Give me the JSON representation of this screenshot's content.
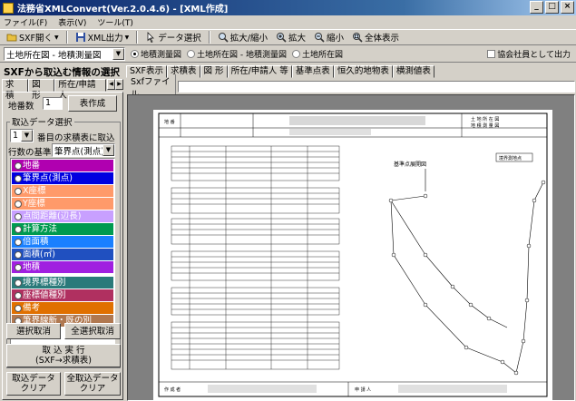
{
  "window": {
    "title": "法務省XMLConvert(Ver.2.0.4.6) - [XML作成]",
    "min": "_",
    "max": "□",
    "close": "×"
  },
  "menu": [
    "ファイル(F)",
    "表示(V)",
    "ツール(T)"
  ],
  "toolbar": {
    "sxf_open": "SXF開く",
    "xml_output": "XML出力",
    "data_select": "データ選択",
    "zoom_in_out": "拡大/縮小",
    "zoom_in": "拡大",
    "zoom_out": "縮小",
    "fit_all": "全体表示"
  },
  "toolbar2": {
    "layer_select": "土地所在図 - 地積測量図",
    "radio_survey": "地積測量図",
    "radio_both": "土地所在図 - 地積測量図",
    "radio_location": "土地所在図",
    "checkbox_label": "協会社員として出力"
  },
  "left": {
    "title": "SXFから取込む情報の選択",
    "tabs": [
      "求 積",
      "図 形",
      "所在/申請人"
    ],
    "lot_count_label": "地番数",
    "lot_count_value": "1",
    "create_table_btn": "表作成",
    "group_title": "取込データ選択",
    "row_select_value": "1",
    "row_select_label": "番目の求積表に取込",
    "row_basis_label": "行数の基準",
    "row_basis_value": "筆界点(測点)",
    "items": [
      {
        "label": "地番",
        "color": "#b000b0"
      },
      {
        "label": "筆界点(測点)",
        "color": "#0000e0"
      },
      {
        "label": "X座標",
        "color": "#ff9a6a"
      },
      {
        "label": "Y座標",
        "color": "#ff9a6a"
      },
      {
        "label": "点間距離(辺長)",
        "color": "#c8a0ff"
      },
      {
        "label": "計算方法",
        "color": "#009a50"
      },
      {
        "label": "倍面積",
        "color": "#1a80ff"
      },
      {
        "label": "面積(㎡)",
        "color": "#2050c0"
      },
      {
        "label": "地積",
        "color": "#a020e0"
      },
      {
        "label": "境界標種別",
        "color": "#2a7a7a"
      },
      {
        "label": "座標値種別",
        "color": "#b03060"
      },
      {
        "label": "備考",
        "color": "#e07000"
      },
      {
        "label": "筆界線新・既の別",
        "color": "#b07850"
      }
    ],
    "deselect_btn": "選択取消",
    "deselect_all_btn": "全選択取消",
    "import_btn_l1": "取 込 実 行",
    "import_btn_l2": "(SXF→求積表)",
    "clear_btn_l1": "取込データ",
    "clear_btn_l2": "クリア",
    "clear_all_btn_l1": "全取込データ",
    "clear_all_btn_l2": "クリア"
  },
  "right": {
    "tabs": [
      "SXF表示",
      "求積表",
      "図 形",
      "所在/申請人 等",
      "基準点表",
      "恒久的地物表",
      "横測値表"
    ],
    "sxf_label": "Sxfファイル"
  },
  "drawing": {
    "header_right_l1": "土 地 所 在 図",
    "header_right_l2": "地 積 測 量 図",
    "header_left": "地 番",
    "diagram_title": "基準点展開図",
    "survey_label": "境界測地点",
    "footer_left": "作 成 者",
    "footer_mid": "申 請 人"
  }
}
